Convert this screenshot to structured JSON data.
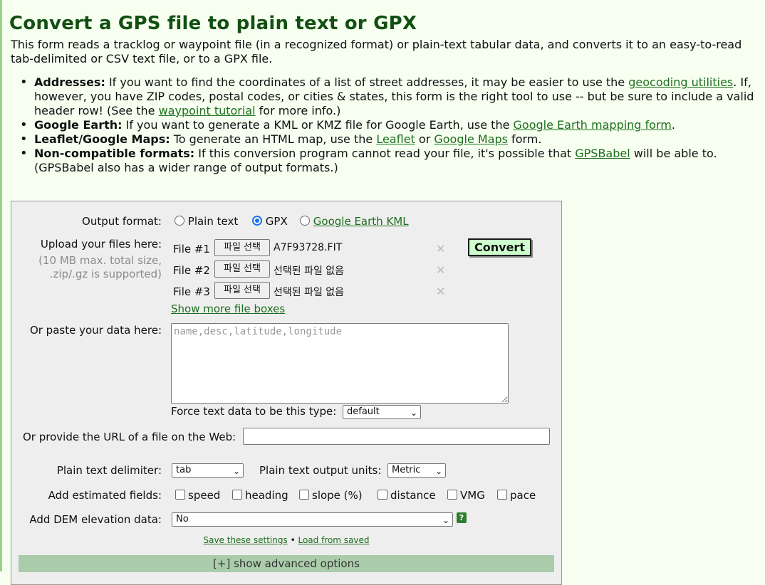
{
  "page": {
    "title": "Convert a GPS file to plain text or GPX",
    "intro": "This form reads a tracklog or waypoint file (in a recognized format) or plain-text tabular data, and converts it to an easy-to-read tab-delimited or CSV text file, or to a GPX file."
  },
  "bullets": {
    "addresses": {
      "heading": "Addresses:",
      "text1": " If you want to find the coordinates of a list of street addresses, it may be easier to use the ",
      "link1": "geocoding utilities",
      "text2": ". If, however, you have ZIP codes, postal codes, or cities & states, this form is the right tool to use -- but be sure to include a valid header row! (See the ",
      "link2": "waypoint tutorial",
      "text3": " for more info.)"
    },
    "google_earth": {
      "heading": "Google Earth:",
      "text1": " If you want to generate a KML or KMZ file for Google Earth, use the ",
      "link1": "Google Earth mapping form",
      "text2": "."
    },
    "leaflet": {
      "heading": "Leaflet/Google Maps:",
      "text1": " To generate an HTML map, use the ",
      "link1": "Leaflet",
      "text2": " or ",
      "link2": "Google Maps",
      "text3": " form."
    },
    "noncompat": {
      "heading": "Non-compatible formats:",
      "text1": " If this conversion program cannot read your file, it's possible that ",
      "link1": "GPSBabel",
      "text2": " will be able to. (GPSBabel also has a wider range of output formats.)"
    }
  },
  "form": {
    "output_format_label": "Output format:",
    "output_options": {
      "plain": "Plain text",
      "gpx": "GPX",
      "kml": "Google Earth KML"
    },
    "selected_output": "GPX",
    "upload_label": "Upload your files here:",
    "upload_note": "(10 MB max. total size,",
    "upload_note2": ".zip/.gz is supported)",
    "files": [
      {
        "label": "File #1",
        "button": "파일 선택",
        "status": "A7F93728.FIT"
      },
      {
        "label": "File #2",
        "button": "파일 선택",
        "status": "선택된 파일 없음"
      },
      {
        "label": "File #3",
        "button": "파일 선택",
        "status": "선택된 파일 없음"
      }
    ],
    "remove_symbol": "✕",
    "convert_label": "Convert",
    "show_more": "Show more file boxes",
    "paste_label": "Or paste your data here:",
    "paste_placeholder": "name,desc,latitude,longitude",
    "force_type_label": "Force text data to be this type:",
    "force_type_value": "default",
    "url_label": "Or provide the URL of a file on the Web:",
    "url_value": "",
    "delimiter_label": "Plain text delimiter:",
    "delimiter_value": "tab",
    "units_label": "Plain text output units:",
    "units_value": "Metric",
    "estimated_label": "Add estimated fields:",
    "estimated_fields": [
      "speed",
      "heading",
      "slope (%)",
      "distance",
      "VMG",
      "pace"
    ],
    "dem_label": "Add DEM elevation data:",
    "dem_value": "No",
    "help_symbol": "?",
    "save_settings": "Save these settings",
    "separator": "•",
    "load_saved": "Load from saved",
    "advanced": "[+] show advanced options"
  },
  "colors": {
    "page_bg": "#f6fff0",
    "title": "#124f12",
    "link": "#1c6f1c",
    "convert_bg": "#ccffcc",
    "advanced_bar": "#aaccaa"
  }
}
